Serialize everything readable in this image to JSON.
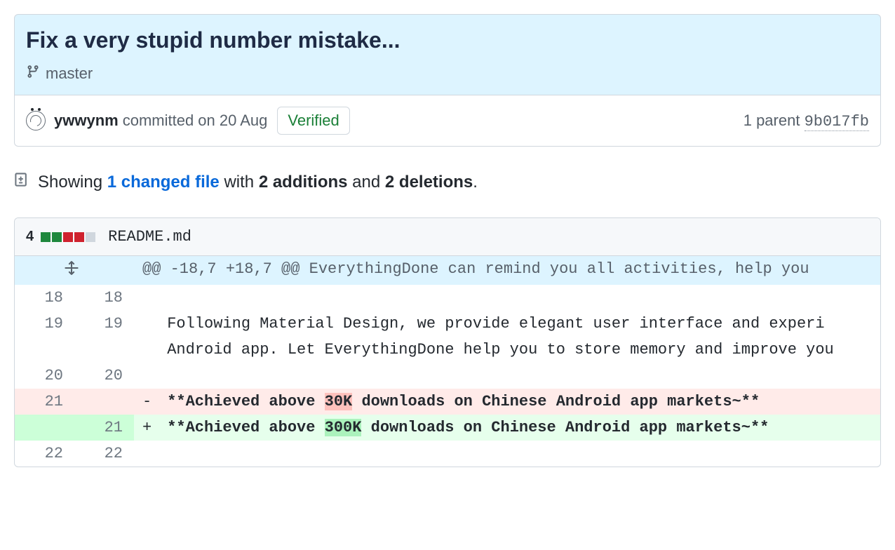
{
  "commit": {
    "title": "Fix a very stupid number mistake...",
    "branch": "master",
    "author": "ywwynm",
    "committed_text": "committed on 20 Aug",
    "verified_label": "Verified",
    "parent_label": "1 parent",
    "parent_sha": "9b017fb"
  },
  "diffstat": {
    "showing": "Showing",
    "changed_files_link": "1 changed file",
    "with": "with",
    "additions": "2 additions",
    "and": "and",
    "deletions": "2 deletions",
    "period": "."
  },
  "file": {
    "change_count": "4",
    "name": "README.md",
    "hunk_header": "@@ -18,7 +18,7 @@ EverythingDone can remind you all activities, help you",
    "rows": [
      {
        "old": "18",
        "new": "18",
        "type": "ctx",
        "code": ""
      },
      {
        "old": "19",
        "new": "19",
        "type": "ctx",
        "code": "Following Material Design, we provide elegant user interface and experi"
      },
      {
        "old": "",
        "new": "",
        "type": "ctx-wrap",
        "code": "Android app. Let EverythingDone help you to store memory and improve you"
      },
      {
        "old": "20",
        "new": "20",
        "type": "ctx",
        "code": ""
      },
      {
        "old": "21",
        "new": "",
        "type": "del",
        "prefix": "**Achieved above ",
        "highlight": "30K",
        "suffix": " downloads on Chinese Android app markets~**"
      },
      {
        "old": "",
        "new": "21",
        "type": "add",
        "prefix": "**Achieved above ",
        "highlight": "300K",
        "suffix": " downloads on Chinese Android app markets~**"
      },
      {
        "old": "22",
        "new": "22",
        "type": "ctx",
        "code": ""
      }
    ]
  }
}
